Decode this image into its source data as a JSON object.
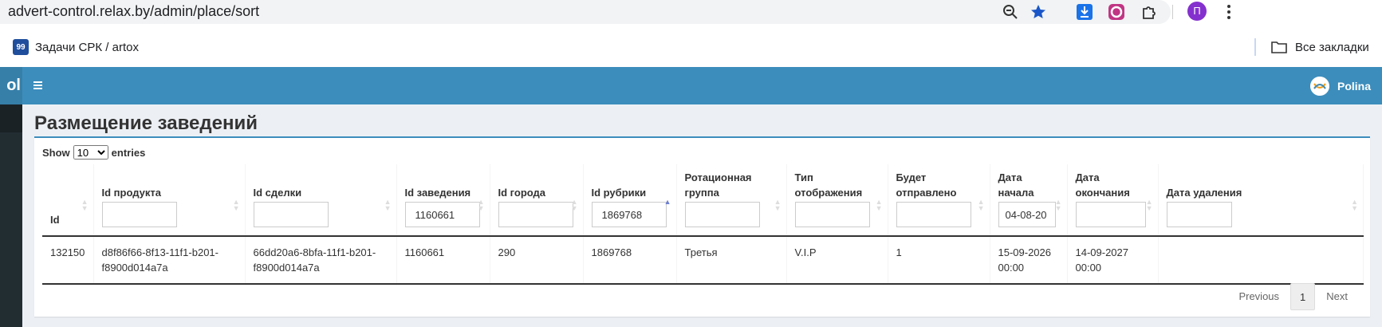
{
  "browser": {
    "url": "advert-control.relax.by/admin/place/sort",
    "bookmark": {
      "favicon": "99",
      "label": "Задачи СРК / artox"
    },
    "all_bookmarks": "Все закладки",
    "profile_initial": "П"
  },
  "app": {
    "logo_fragment": "ol",
    "user_name": "Polina",
    "header_color": "#3c8dbc"
  },
  "page": {
    "title": "Размещение заведений"
  },
  "table_controls": {
    "show_label": "Show",
    "entries_value": "10",
    "entries_label": "entries"
  },
  "columns": [
    {
      "label": "Id",
      "filter": null
    },
    {
      "label": "Id продукта",
      "filter": ""
    },
    {
      "label": "Id сделки",
      "filter": ""
    },
    {
      "label": "Id заведения",
      "filter": "1160661"
    },
    {
      "label": "Id города",
      "filter": ""
    },
    {
      "label": "Id рубрики",
      "filter": "1869768"
    },
    {
      "label": "Ротационная группа",
      "filter": ""
    },
    {
      "label": "Тип отображения",
      "filter": ""
    },
    {
      "label": "Будет отправлено",
      "filter": ""
    },
    {
      "label": "Дата начала",
      "filter": "04-08-20"
    },
    {
      "label": "Дата окончания",
      "filter": ""
    },
    {
      "label": "Дата удаления",
      "filter": ""
    }
  ],
  "rows": [
    [
      "132150",
      "d8f86f66-8f13-11f1-b201-f8900d014a7a",
      "66dd20a6-8bfa-11f1-b201-f8900d014a7a",
      "1160661",
      "290",
      "1869768",
      "Третья",
      "V.I.P",
      "1",
      "15-09-2026 00:00",
      "14-09-2027 00:00",
      ""
    ]
  ],
  "pagination": {
    "previous": "Previous",
    "current": "1",
    "next": "Next"
  }
}
